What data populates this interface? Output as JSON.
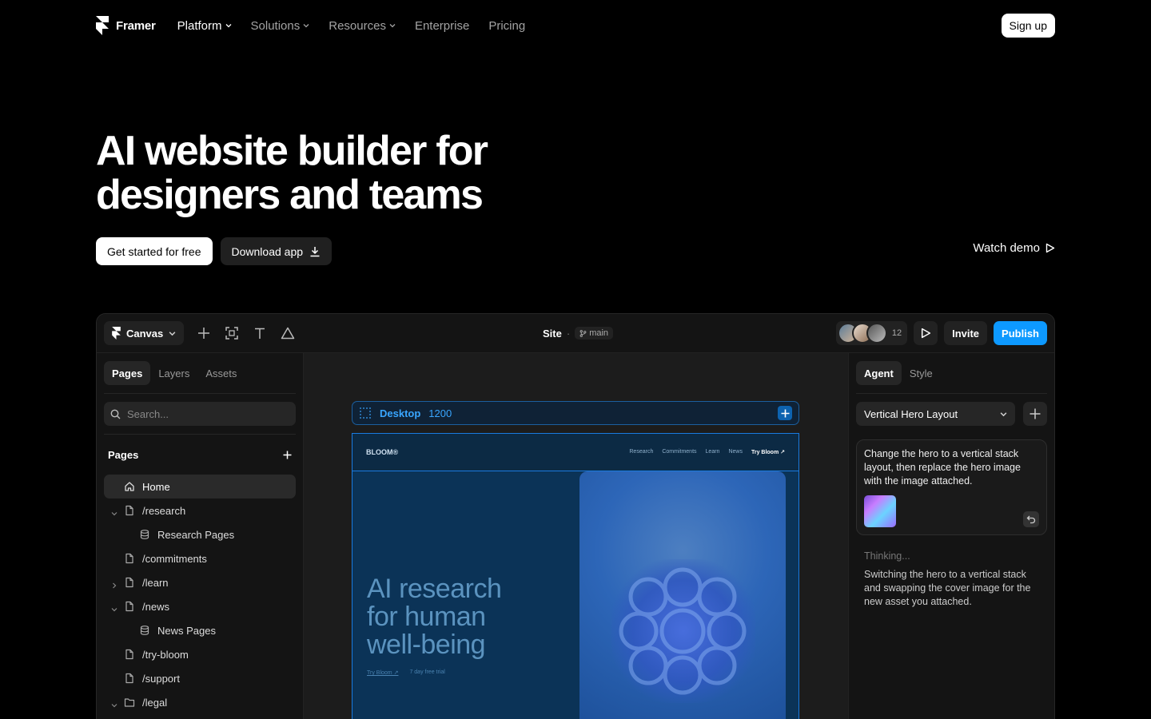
{
  "nav": {
    "brand": "Framer",
    "links": [
      {
        "label": "Platform",
        "dropdown": true,
        "active": true
      },
      {
        "label": "Solutions",
        "dropdown": true,
        "active": false
      },
      {
        "label": "Resources",
        "dropdown": true,
        "active": false
      },
      {
        "label": "Enterprise",
        "dropdown": false,
        "active": false
      },
      {
        "label": "Pricing",
        "dropdown": false,
        "active": false
      }
    ],
    "signup": "Sign up"
  },
  "hero": {
    "title_line1": "AI website builder for",
    "title_line2": "designers and teams",
    "primary_cta": "Get started for free",
    "secondary_cta": "Download app",
    "watch_demo": "Watch demo"
  },
  "app": {
    "toolbar": {
      "canvas_label": "Canvas",
      "site_label": "Site",
      "branch": "main",
      "collaborator_count": "12",
      "invite": "Invite",
      "publish": "Publish"
    },
    "left": {
      "tabs": [
        "Pages",
        "Layers",
        "Assets"
      ],
      "search_placeholder": "Search...",
      "pages_heading": "Pages",
      "pages": [
        {
          "label": "Home",
          "icon": "home-icon",
          "caret": "",
          "active": true
        },
        {
          "label": "/research",
          "icon": "page-icon",
          "caret": "down",
          "active": false
        },
        {
          "label": "Research Pages",
          "icon": "database-icon",
          "caret": "",
          "active": false,
          "nested": true
        },
        {
          "label": "/commitments",
          "icon": "page-icon",
          "caret": "",
          "active": false
        },
        {
          "label": "/learn",
          "icon": "page-icon",
          "caret": "right",
          "active": false
        },
        {
          "label": "/news",
          "icon": "page-icon",
          "caret": "down",
          "active": false
        },
        {
          "label": "News Pages",
          "icon": "database-icon",
          "caret": "",
          "active": false,
          "nested": true
        },
        {
          "label": "/try-bloom",
          "icon": "page-icon",
          "caret": "",
          "active": false
        },
        {
          "label": "/support",
          "icon": "page-icon",
          "caret": "",
          "active": false
        },
        {
          "label": "/legal",
          "icon": "folder-icon",
          "caret": "down",
          "active": false
        }
      ]
    },
    "canvas": {
      "frame_name": "Desktop",
      "frame_width": "1200",
      "site": {
        "logo": "BLOOM®",
        "links": [
          "Research",
          "Commitments",
          "Learn",
          "News"
        ],
        "cta": "Try Bloom ↗",
        "headline_line1": "AI research",
        "headline_line2": "for human",
        "headline_line3": "well-being",
        "try_link": "Try Bloom ↗",
        "trial_note": "7 day free trial"
      }
    },
    "right": {
      "tabs": [
        "Agent",
        "Style"
      ],
      "layout_select": "Vertical Hero Layout",
      "prompt": "Change the hero to a vertical stack layout, then replace the hero image with the image attached.",
      "thinking_label": "Thinking...",
      "thinking_text": "Switching the hero to a vertical stack and swapping the cover image for the new asset you attached."
    }
  },
  "colors": {
    "accent": "#0d99ff",
    "background": "#000000",
    "panel": "#141414"
  }
}
